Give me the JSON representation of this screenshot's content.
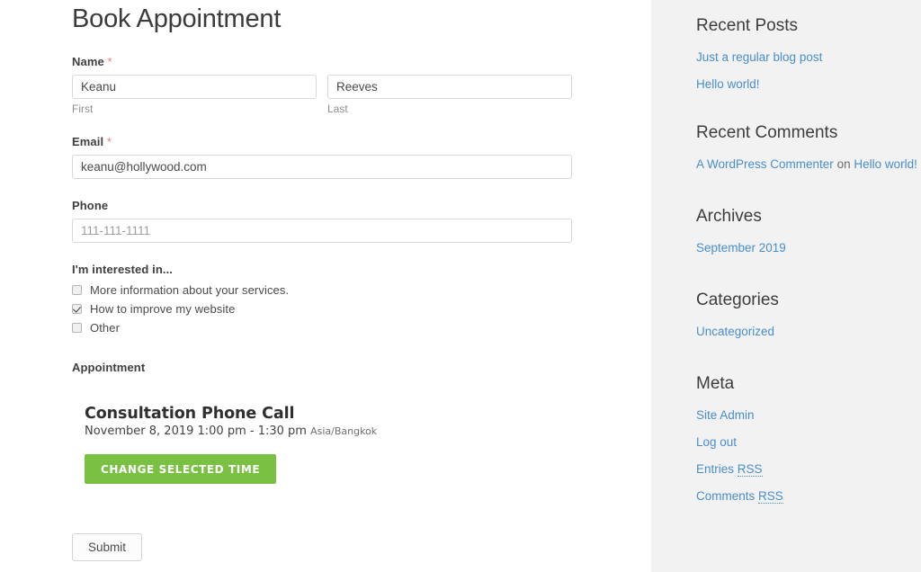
{
  "form": {
    "title": "Book Appointment",
    "name": {
      "label": "Name",
      "required_mark": "*",
      "first": {
        "value": "Keanu",
        "sub_label": "First",
        "placeholder": ""
      },
      "last": {
        "value": "Reeves",
        "sub_label": "Last",
        "placeholder": ""
      }
    },
    "email": {
      "label": "Email",
      "required_mark": "*",
      "value": "keanu@hollywood.com",
      "placeholder": ""
    },
    "phone": {
      "label": "Phone",
      "value": "",
      "placeholder": "111-111-1111"
    },
    "interest": {
      "label": "I'm interested in...",
      "options": [
        {
          "label": "More information about your services.",
          "checked": false
        },
        {
          "label": "How to improve my website",
          "checked": true
        },
        {
          "label": "Other",
          "checked": false
        }
      ]
    },
    "appointment": {
      "label": "Appointment",
      "service_title": "Consultation Phone Call",
      "datetime": "November 8, 2019 1:00 pm - 1:30 pm",
      "timezone": "Asia/Bangkok",
      "change_button": "CHANGE SELECTED TIME",
      "button_color": "#7ac143"
    },
    "submit_label": "Submit"
  },
  "sidebar": {
    "background": "#f2f2f2",
    "link_color": "#4a8ecb",
    "widgets": [
      {
        "title": "Recent Posts",
        "items": [
          {
            "text": "Just a regular blog post"
          },
          {
            "text": "Hello world!"
          }
        ]
      },
      {
        "title": "Recent Comments",
        "items": [
          {
            "author": "A WordPress Commenter",
            "separator": "on",
            "post": "Hello world!"
          }
        ]
      },
      {
        "title": "Archives",
        "items": [
          {
            "text": "September 2019"
          }
        ]
      },
      {
        "title": "Categories",
        "items": [
          {
            "text": "Uncategorized"
          }
        ]
      },
      {
        "title": "Meta",
        "items": [
          {
            "text": "Site Admin"
          },
          {
            "text": "Log out"
          },
          {
            "text": "Entries ",
            "abbr": "RSS"
          },
          {
            "text": "Comments ",
            "abbr": "RSS"
          }
        ]
      }
    ]
  }
}
